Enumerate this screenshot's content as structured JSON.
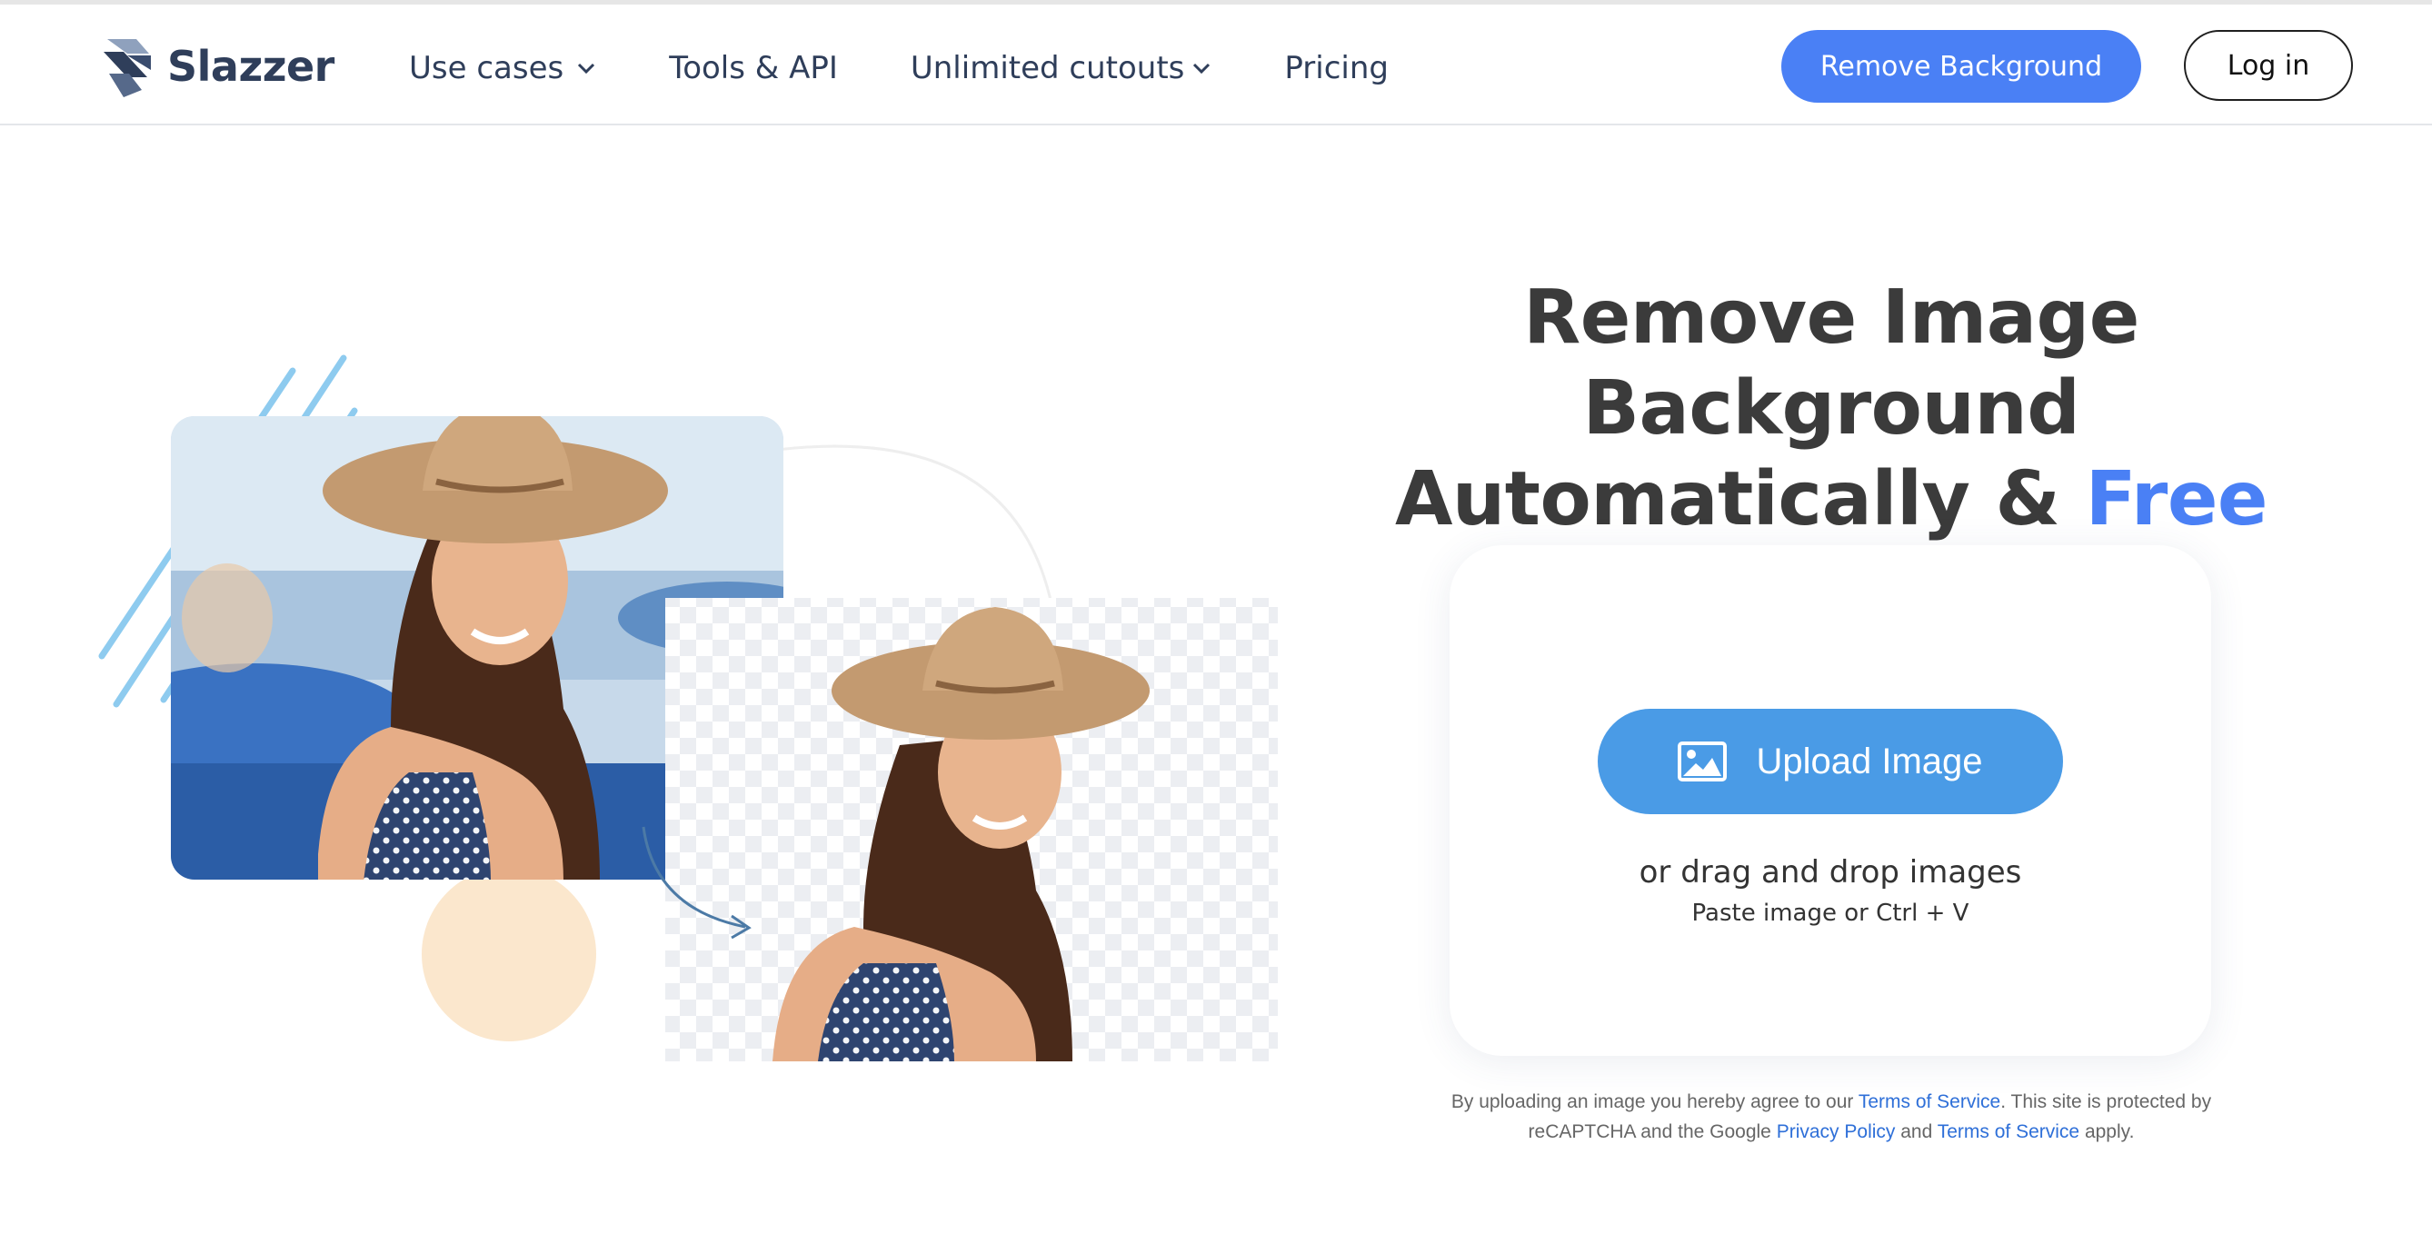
{
  "brand": {
    "name": "Slazzer",
    "color": "#2f3e5a",
    "accent": "#4a80f5"
  },
  "nav": {
    "items": [
      {
        "label": "Use cases",
        "has_dropdown": true
      },
      {
        "label": "Tools & API",
        "has_dropdown": false
      },
      {
        "label": "Unlimited cutouts",
        "has_dropdown": true
      },
      {
        "label": "Pricing",
        "has_dropdown": false
      }
    ],
    "cta_label": "Remove Background",
    "login_label": "Log in"
  },
  "hero": {
    "title_line1": "Remove Image Background",
    "title_line2_prefix": "Automatically & ",
    "title_line2_accent": "Free"
  },
  "upload": {
    "button_label": "Upload Image",
    "button_icon": "image-icon",
    "drag_text": "or drag and drop images",
    "paste_text": "Paste image or Ctrl + V"
  },
  "disclaimer": {
    "part1": "By uploading an image you hereby agree to our ",
    "tos_link": "Terms of Service",
    "part2": ". This site is protected by reCAPTCHA and the Google ",
    "privacy_link": "Privacy Policy",
    "part3": " and ",
    "tos_link2": "Terms of Service",
    "part4": " apply."
  },
  "colors": {
    "upload_button": "#4a9be6",
    "link": "#2e6fd8",
    "decor_lines": "#8ecbef",
    "decor_circle": "#fbe7cd"
  }
}
